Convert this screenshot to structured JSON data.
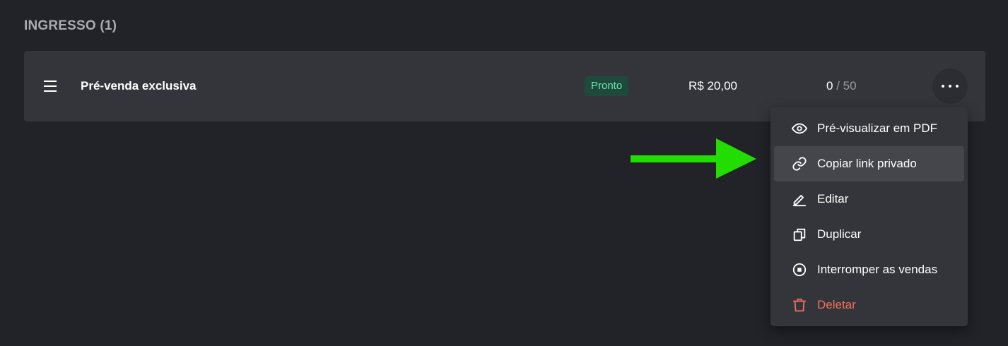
{
  "section": {
    "title": "INGRESSO (1)"
  },
  "ticket": {
    "name": "Pré-venda exclusiva",
    "status": "Pronto",
    "price": "R$ 20,00",
    "sold": "0",
    "separator": "/",
    "total": "50",
    "more_icon": "more-horizontal-icon"
  },
  "menu": {
    "items": [
      {
        "label": "Pré-visualizar em PDF",
        "icon": "eye-icon"
      },
      {
        "label": "Copiar link privado",
        "icon": "link-icon",
        "highlighted": true
      },
      {
        "label": "Editar",
        "icon": "pencil-icon"
      },
      {
        "label": "Duplicar",
        "icon": "copy-icon"
      },
      {
        "label": "Interromper as vendas",
        "icon": "stop-circle-icon"
      },
      {
        "label": "Deletar",
        "icon": "trash-icon",
        "danger": true
      }
    ]
  },
  "colors": {
    "background": "#212328",
    "card": "#34353a",
    "status_bg": "#1e4a3c",
    "status_text": "#6ee3b0",
    "danger": "#f0715d",
    "annotation_arrow": "#22dd00"
  }
}
